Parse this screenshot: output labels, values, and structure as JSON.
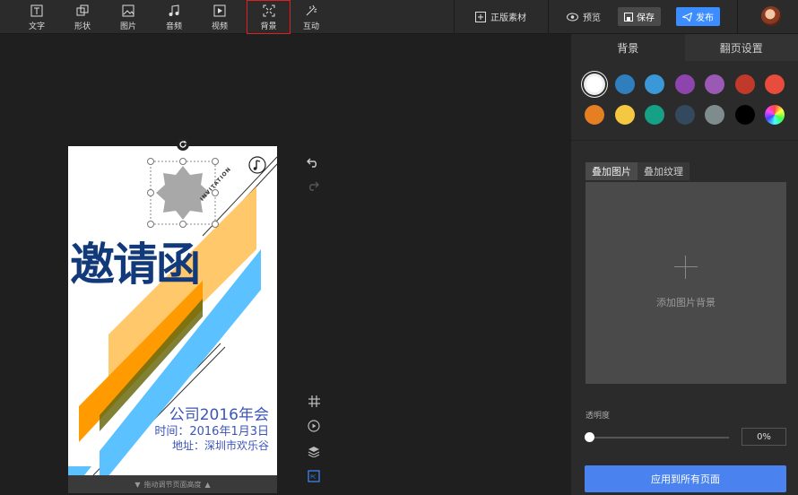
{
  "toolbar": {
    "tools": [
      {
        "label": "文字",
        "icon": "text-icon"
      },
      {
        "label": "形状",
        "icon": "shape-icon"
      },
      {
        "label": "图片",
        "icon": "image-icon"
      },
      {
        "label": "音频",
        "icon": "music-icon"
      },
      {
        "label": "视频",
        "icon": "video-icon"
      },
      {
        "label": "背景",
        "icon": "background-icon",
        "active": true
      },
      {
        "label": "互动",
        "icon": "interact-icon"
      }
    ],
    "assets_label": "正版素材",
    "preview_label": "预览",
    "save_label": "保存",
    "publish_label": "发布"
  },
  "canvas": {
    "title": "邀请函",
    "invitation": "INVITATION",
    "event": "公司2016年会",
    "time": "时间：2016年1月3日",
    "address": "地址：深圳市欢乐谷",
    "handle_label": "拖动调节页面高度"
  },
  "panel": {
    "tab_background": "背景",
    "tab_page_turn": "翻页设置",
    "colors": [
      "#ffffff",
      "#2f7fbf",
      "#3a98d8",
      "#8e44ad",
      "#9b59b6",
      "#c0392b",
      "#e74c3c",
      "#e67e22",
      "#f5c842",
      "#16a085",
      "#34495e",
      "#7f8c8d",
      "#000000",
      "rainbow"
    ],
    "subtab_image": "叠加图片",
    "subtab_texture": "叠加纹理",
    "upload_label": "添加图片背景",
    "opacity_label": "透明度",
    "opacity_value": "0%",
    "opacity_fraction": 0,
    "apply_label": "应用到所有页面"
  }
}
